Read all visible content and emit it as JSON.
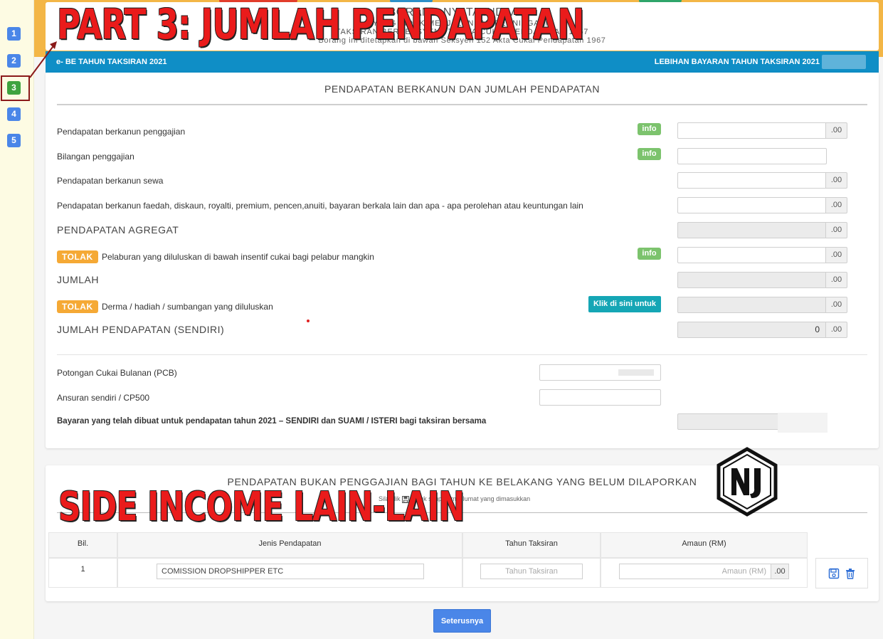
{
  "steps": [
    {
      "label": "1",
      "active": false
    },
    {
      "label": "2",
      "active": false
    },
    {
      "label": "3",
      "active": true
    },
    {
      "label": "4",
      "active": false
    },
    {
      "label": "5",
      "active": false
    }
  ],
  "header": {
    "title": "BORANG NYATA INDIVIDU",
    "line1": "YANG TIDAK MENJALANKAN PERNIAGAAN",
    "line2": "TAKSIRAN BERSEKSYEN 77 AKTA CUKAI PENDAPATAN 1967",
    "line3": "Borang ini ditetapkan di bawah Seksyen 152 Akta Cukai Pendapatan 1967"
  },
  "bluebar": {
    "left": "e- BE TAHUN TAKSIRAN 2021",
    "right": "LEBIHAN BAYARAN TAHUN TAKSIRAN 2021"
  },
  "main": {
    "section_title": "PENDAPATAN BERKANUN DAN JUMLAH PENDAPATAN",
    "rows": {
      "employment": "Pendapatan berkanun penggajian",
      "employment_count": "Bilangan penggajian",
      "rent": "Pendapatan berkanun sewa",
      "interest": "Pendapatan berkanun faedah, diskaun, royalti, premium, pencen,anuiti, bayaran berkala lain dan apa - apa perolehan atau keuntungan lain",
      "aggregate": "PENDAPATAN AGREGAT",
      "angel": "Pelaburan yang diluluskan di bawah insentif cukai bagi pelabur mangkin",
      "jumlah": "JUMLAH",
      "donation": "Derma / hadiah / sumbangan yang diluluskan",
      "total_self": "JUMLAH PENDAPATAN (SENDIRI)",
      "pcb": "Potongan Cukai Bulanan (PCB)",
      "cp500": "Ansuran sendiri / CP500",
      "payments": "Bayaran yang telah dibuat untuk pendapatan tahun 2021 – SENDIRI dan SUAMI / ISTERI bagi taksiran bersama"
    },
    "tolak_label": "TOLAK",
    "info_label": "info",
    "klik_label": "Klik di sini untuk isi",
    "suffix": ".00",
    "total_value": "0"
  },
  "side": {
    "section_title": "PENDAPATAN BUKAN PENGGAJIAN BAGI TAHUN KE BELAKANG YANG BELUM DILAPORKAN",
    "note_pre": "Sila klik",
    "note_post": "untuk simpan maklumat yang dimasukkan",
    "headers": [
      "Bil.",
      "Jenis Pendapatan",
      "Tahun Taksiran",
      "Amaun (RM)"
    ],
    "row": {
      "bil": "1",
      "jenis": "COMISSION DROPSHIPPER ETC",
      "tahun_placeholder": "Tahun Taksiran",
      "amaun_placeholder": "Amaun (RM)",
      "suffix": ".00"
    }
  },
  "next_label": "Seterusnya",
  "overlays": {
    "part_title": "PART 3: JUMLAH PENDAPATAN",
    "side_title": "SIDE INCOME LAIN-LAIN",
    "logo_text": "NJ"
  },
  "colors": {
    "accent_blue": "#0f8ec6",
    "button_blue": "#4a86e8",
    "tolak_orange": "#f5a935",
    "info_green": "#7cc36d",
    "klik_teal": "#15a6b5",
    "overlay_red": "#ea1b1b"
  }
}
